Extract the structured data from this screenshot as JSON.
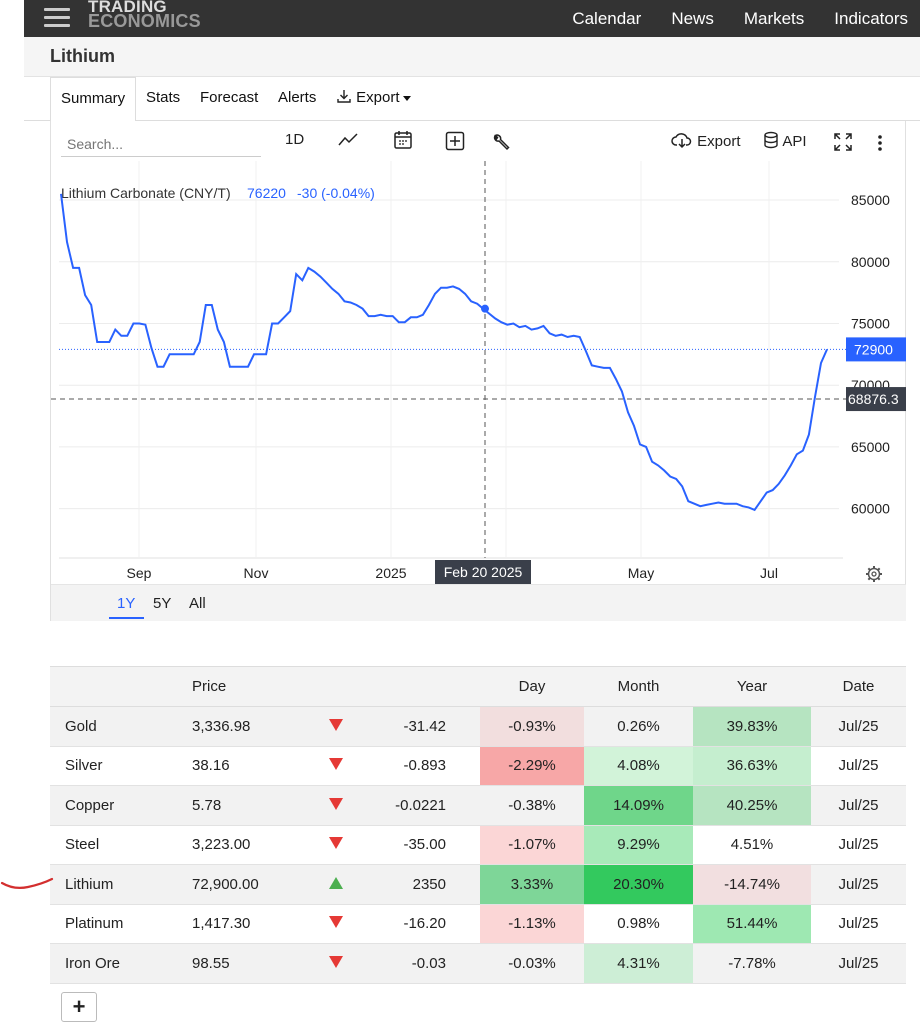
{
  "header": {
    "logo_line1": "TRADING",
    "logo_line2": "ECONOMICS",
    "nav": [
      "Calendar",
      "News",
      "Markets",
      "Indicators"
    ]
  },
  "page_title": "Lithium",
  "tabs": {
    "summary": "Summary",
    "stats": "Stats",
    "forecast": "Forecast",
    "alerts": "Alerts",
    "export": "Export"
  },
  "toolbar": {
    "search_placeholder": "Search...",
    "interval": "1D",
    "export": "Export",
    "api": "API"
  },
  "chart_data": {
    "type": "line",
    "title": "Lithium Carbonate (CNY/T)",
    "legend_value": "76220",
    "legend_change": "-30 (-0.04%)",
    "y_ticks": [
      60000,
      65000,
      70000,
      75000,
      80000,
      85000
    ],
    "y_range": [
      56000,
      88000
    ],
    "x_ticks": [
      "Sep",
      "Nov",
      "2025",
      "May",
      "Jul"
    ],
    "last_price_label": "72900",
    "crosshair_price_label": "68876.3",
    "crosshair_date_label": "Feb 20 2025",
    "series": [
      {
        "values": [
          85500,
          81600,
          79500,
          79500,
          77300,
          76500,
          73500,
          73500,
          73500,
          74500,
          74000,
          74000,
          75000,
          75000,
          74900,
          73000,
          71500,
          71500,
          72500,
          72500,
          72500,
          72500,
          72500,
          73500,
          76500,
          76500,
          74500,
          73500,
          71500,
          71500,
          71500,
          71500,
          72500,
          72500,
          72500,
          75000,
          75000,
          75500,
          76000,
          79000,
          78500,
          79500,
          79200,
          78800,
          78300,
          77800,
          77400,
          76800,
          76700,
          76500,
          76200,
          75600,
          75600,
          75700,
          75600,
          75600,
          75100,
          75100,
          75500,
          75500,
          75700,
          76500,
          77400,
          77900,
          77900,
          78000,
          77800,
          77400,
          76800,
          76600,
          76200,
          75800,
          75400,
          75100,
          74900,
          75000,
          74700,
          74800,
          74500,
          74600,
          74800,
          74200,
          74000,
          74100,
          73900,
          74000,
          73900,
          72800,
          71600,
          71500,
          71400,
          71400,
          70500,
          69500,
          67800,
          66700,
          65200,
          65000,
          63800,
          63500,
          63100,
          62600,
          62400,
          61800,
          60600,
          60400,
          60200,
          60300,
          60400,
          60500,
          60400,
          60400,
          60400,
          60200,
          60100,
          59900,
          60600,
          61300,
          61500,
          62000,
          62700,
          63500,
          64400,
          64700,
          66000,
          69000,
          71800,
          72900
        ]
      }
    ]
  },
  "ranges": [
    "1Y",
    "5Y",
    "All"
  ],
  "table": {
    "headers": {
      "name": "",
      "price": "Price",
      "day": "Day",
      "month": "Month",
      "year": "Year",
      "date": "Date"
    },
    "rows": [
      {
        "name": "Gold",
        "price": "3,336.98",
        "dir": "down",
        "change": "-31.42",
        "day": "-0.93%",
        "month": "0.26%",
        "year": "39.83%",
        "date": "Jul/25",
        "day_bg": "#f2dede",
        "month_bg": "",
        "year_bg": "#b6e4c1"
      },
      {
        "name": "Silver",
        "price": "38.16",
        "dir": "down",
        "change": "-0.893",
        "day": "-2.29%",
        "month": "4.08%",
        "year": "36.63%",
        "date": "Jul/25",
        "day_bg": "#f7a7a7",
        "month_bg": "#d2f3d9",
        "year_bg": "#c5eecf"
      },
      {
        "name": "Copper",
        "price": "5.78",
        "dir": "down",
        "change": "-0.0221",
        "day": "-0.38%",
        "month": "14.09%",
        "year": "40.25%",
        "date": "Jul/25",
        "day_bg": "",
        "month_bg": "#6fd68a",
        "year_bg": "#b6e4c1"
      },
      {
        "name": "Steel",
        "price": "3,223.00",
        "dir": "down",
        "change": "-35.00",
        "day": "-1.07%",
        "month": "9.29%",
        "year": "4.51%",
        "date": "Jul/25",
        "day_bg": "#fbd6d6",
        "month_bg": "#a8eab9",
        "year_bg": ""
      },
      {
        "name": "Lithium",
        "price": "72,900.00",
        "dir": "up",
        "change": "2350",
        "day": "3.33%",
        "month": "20.30%",
        "year": "-14.74%",
        "date": "Jul/25",
        "day_bg": "#7ed698",
        "month_bg": "#33c95e",
        "year_bg": "#f2dfe0"
      },
      {
        "name": "Platinum",
        "price": "1,417.30",
        "dir": "down",
        "change": "-16.20",
        "day": "-1.13%",
        "month": "0.98%",
        "year": "51.44%",
        "date": "Jul/25",
        "day_bg": "#fbd6d6",
        "month_bg": "",
        "year_bg": "#9ee8b2"
      },
      {
        "name": "Iron Ore",
        "price": "98.55",
        "dir": "down",
        "change": "-0.03",
        "day": "-0.03%",
        "month": "4.31%",
        "year": "-7.78%",
        "date": "Jul/25",
        "day_bg": "",
        "month_bg": "#cdeed6",
        "year_bg": ""
      }
    ]
  },
  "add_button": "+",
  "colors": {
    "line": "#2962ff",
    "annotation": "#d32f2f",
    "header_bg": "#333333"
  }
}
